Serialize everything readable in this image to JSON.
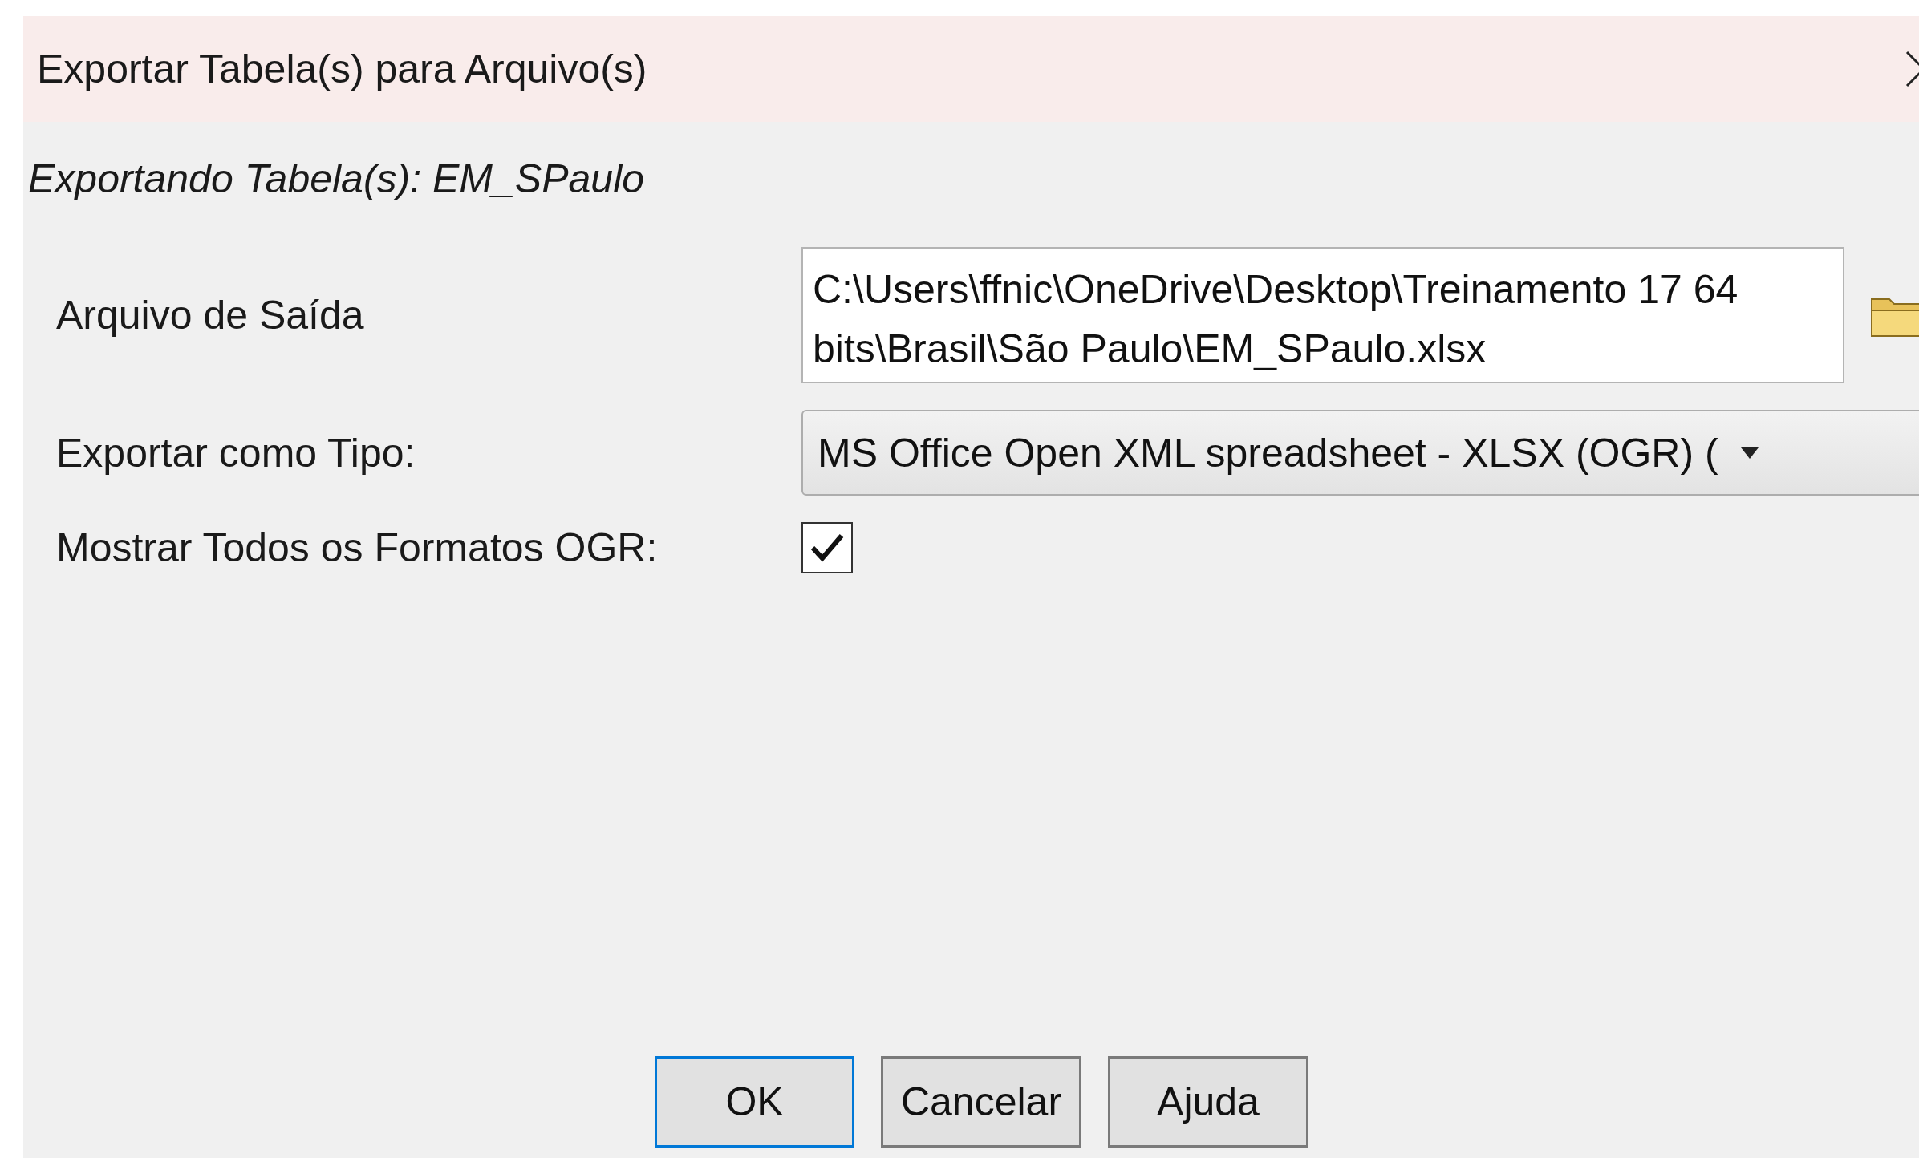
{
  "window": {
    "title": "Exportar Tabela(s) para Arquivo(s)"
  },
  "subtitle": "Exportando Tabela(s): EM_SPaulo",
  "fields": [
    {
      "kind": "file",
      "label": "Arquivo de Saída",
      "value": "C:\\Users\\ffnic\\OneDrive\\Desktop\\Treinamento 17 64 bits\\Brasil\\São Paulo\\EM_SPaulo.xlsx"
    },
    {
      "kind": "select",
      "label": "Exportar como Tipo:",
      "value": "MS Office Open XML spreadsheet - XLSX (OGR) ("
    },
    {
      "kind": "checkbox",
      "label": "Mostrar Todos os Formatos OGR:",
      "checked": true
    }
  ],
  "buttons": [
    {
      "label": "OK",
      "default": true
    },
    {
      "label": "Cancelar",
      "default": false
    },
    {
      "label": "Ajuda",
      "default": false
    }
  ]
}
